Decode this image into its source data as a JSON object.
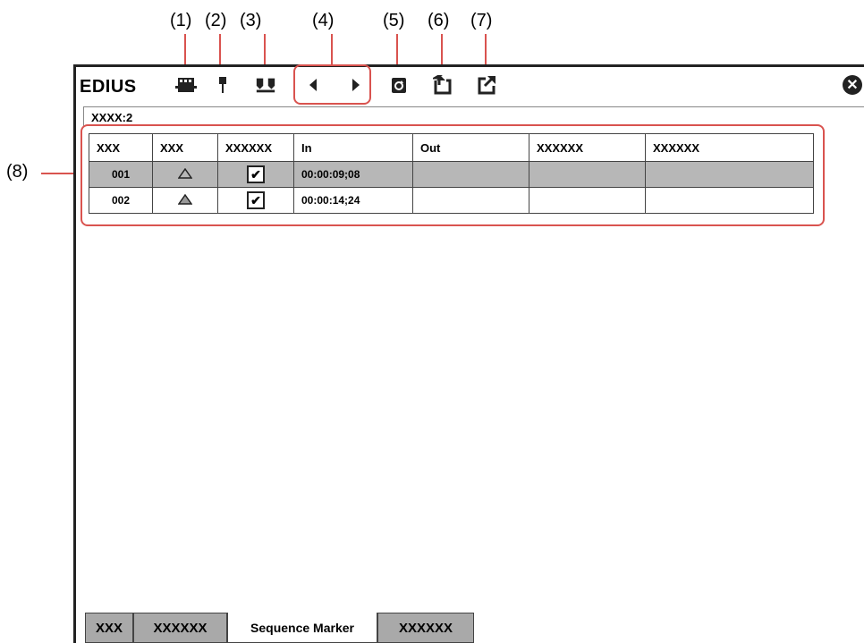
{
  "callouts": [
    "(1)",
    "(2)",
    "(3)",
    "(4)",
    "(5)",
    "(6)",
    "(7)",
    "(8)"
  ],
  "app": {
    "logo": "EDIUS",
    "close_icon": "close-icon"
  },
  "toolbar": {
    "icons": [
      "film-strip-icon",
      "marker-pin-icon",
      "split-marker-icon",
      "prev-arrow-icon",
      "next-arrow-icon",
      "refresh-icon",
      "import-icon",
      "export-icon"
    ]
  },
  "clip_label": "XXXX:2",
  "table": {
    "headers": [
      "XXX",
      "XXX",
      "XXXXXX",
      "In",
      "Out",
      "XXXXXX",
      "XXXXXX"
    ],
    "rows": [
      {
        "no": "001",
        "mark": "hollow-triangle",
        "checked": true,
        "in": "00:00:09;08",
        "out": "",
        "c6": "",
        "c7": ""
      },
      {
        "no": "002",
        "mark": "filled-triangle",
        "checked": true,
        "in": "00:00:14;24",
        "out": "",
        "c6": "",
        "c7": ""
      }
    ]
  },
  "tabs": [
    "XXX",
    "XXXXXX",
    "Sequence Marker",
    "XXXXXX"
  ],
  "colors": {
    "callout": "#d9534f",
    "selected_row": "#b7b7b7",
    "tab_inactive": "#a9a9a9"
  }
}
